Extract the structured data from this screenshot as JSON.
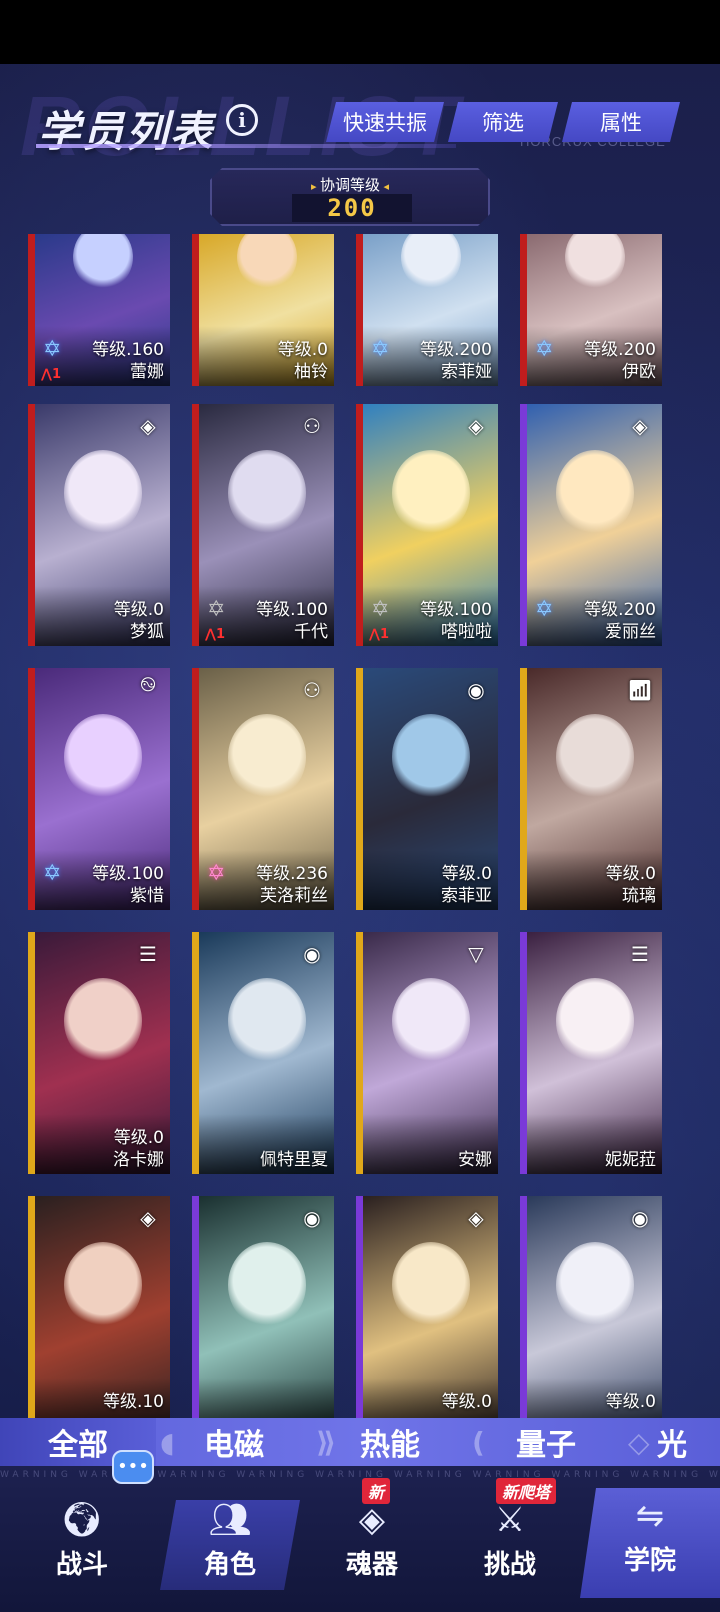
{
  "header": {
    "title": "学员列表",
    "watermark": "ROLLLIST",
    "college_watermark": "HORCRUX COLLEGE",
    "buttons": [
      "快速共振",
      "筛选",
      "属性"
    ]
  },
  "coordination": {
    "label": "协调等级",
    "value": "200"
  },
  "colors": {
    "accent": "#5a5fe0",
    "level_value": "#f5c847",
    "card_border_red": "#c01d1d",
    "card_border_gold": "#e0a81a",
    "card_border_purple": "#7a3ad8"
  },
  "cards": [
    {
      "level": "等级.160",
      "name": "蕾娜",
      "rank": "1",
      "star": "blue"
    },
    {
      "level": "等级.0",
      "name": "柚铃",
      "rank": "",
      "star": ""
    },
    {
      "level": "等级.200",
      "name": "索菲娅",
      "rank": "",
      "star": "blue"
    },
    {
      "level": "等级.200",
      "name": "伊欧",
      "rank": "",
      "star": "blue"
    },
    {
      "level": "等级.0",
      "name": "梦狐",
      "rank": "",
      "star": "",
      "element": "diamond-icon"
    },
    {
      "level": "等级.100",
      "name": "千代",
      "rank": "1",
      "star": "dim",
      "element": "gamepad-icon"
    },
    {
      "level": "等级.100",
      "name": "嗒啦啦",
      "rank": "1",
      "star": "dim",
      "element": "diamond-icon"
    },
    {
      "level": "等级.200",
      "name": "爱丽丝",
      "rank": "",
      "star": "blue",
      "element": "diamond-icon"
    },
    {
      "level": "等级.100",
      "name": "紫惜",
      "rank": "",
      "star": "blue",
      "element": "swirl-icon"
    },
    {
      "level": "等级.236",
      "name": "芙洛莉丝",
      "rank": "",
      "star": "pink",
      "element": "gamepad-icon"
    },
    {
      "level": "等级.0",
      "name": "索菲亚",
      "rank": "",
      "star": "",
      "element": "drop-icon"
    },
    {
      "level": "等级.0",
      "name": "琉璃",
      "rank": "",
      "star": "",
      "element": "wifi-icon"
    },
    {
      "level": "等级.0",
      "name": "洛卡娜",
      "rank": "",
      "star": "",
      "element": "stripes-icon"
    },
    {
      "level": "",
      "name": "佩特里夏",
      "rank": "",
      "star": "",
      "element": "drop-icon"
    },
    {
      "level": "",
      "name": "安娜",
      "rank": "",
      "star": "",
      "element": "triangle-icon"
    },
    {
      "level": "",
      "name": "妮妮菈",
      "rank": "",
      "star": "",
      "element": "stripes-icon"
    },
    {
      "level": "等级.10",
      "name": "",
      "rank": "",
      "star": "",
      "element": "diamond-icon"
    },
    {
      "level": "",
      "name": "",
      "rank": "",
      "star": "",
      "element": "drop-icon"
    },
    {
      "level": "等级.0",
      "name": "",
      "rank": "",
      "star": "",
      "element": "diamond-icon"
    },
    {
      "level": "等级.0",
      "name": "",
      "rank": "",
      "star": "",
      "element": "drop-icon"
    }
  ],
  "tabs": [
    "全部",
    "电磁",
    "热能",
    "量子",
    "光"
  ],
  "nav": [
    {
      "label": "战斗",
      "icon": "globe-icon"
    },
    {
      "label": "角色",
      "icon": "people-icon"
    },
    {
      "label": "魂器",
      "icon": "artifact-icon",
      "badge": "新"
    },
    {
      "label": "挑战",
      "icon": "challenge-icon",
      "badge": "新爬塔"
    },
    {
      "label": "学院",
      "icon": "college-icon"
    }
  ],
  "warning_text": "WARNING WARNING WARNING WARNING WARNING WARNING WARNING WARNING WARNING WARNING"
}
